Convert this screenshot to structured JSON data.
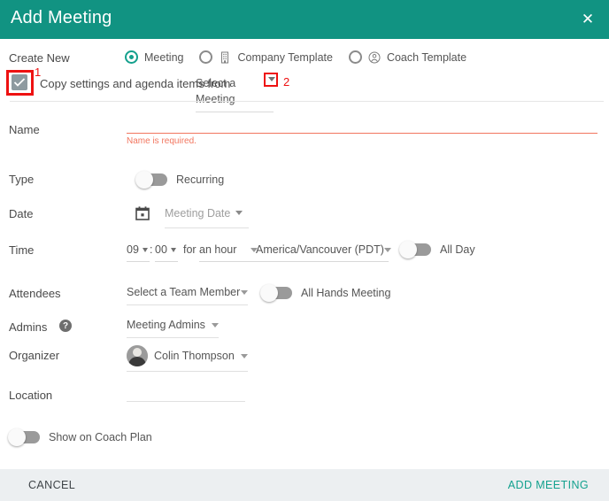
{
  "colors": {
    "header_bg": "#119382",
    "accent": "#13a18e",
    "error": "#f2765f",
    "annotation": "#ee1111",
    "footer_bg": "#eceff1",
    "checkbox_fill": "#8e9aa0"
  },
  "header": {
    "title": "Add Meeting",
    "close_label": "✕"
  },
  "create_new": {
    "label": "Create New",
    "options": [
      {
        "label": "Meeting",
        "selected": true,
        "icon": ""
      },
      {
        "label": "Company Template",
        "selected": false,
        "icon": "building-icon"
      },
      {
        "label": "Coach Template",
        "selected": false,
        "icon": "person-circle-icon"
      }
    ]
  },
  "copy_row": {
    "checkbox_checked": true,
    "label": "Copy settings and agenda items from",
    "select_value": "Select a Meeting",
    "annotation_1": "1",
    "annotation_2": "2"
  },
  "fields": {
    "name": {
      "label": "Name",
      "value": "",
      "placeholder": "",
      "error": "Name is required."
    },
    "type": {
      "label": "Type",
      "toggle_label": "Recurring",
      "toggle_on": false
    },
    "date": {
      "label": "Date",
      "icon": "calendar-icon",
      "select_value": "Meeting Date"
    },
    "time": {
      "label": "Time",
      "hour": "09",
      "colon": ":",
      "minute": "00",
      "for_label": "for",
      "duration": "an hour",
      "timezone": "America/Vancouver (PDT)",
      "allday_label": "All Day",
      "allday_on": false
    },
    "attendees": {
      "label": "Attendees",
      "select_value": "Select a Team Member",
      "allhands_label": "All Hands Meeting",
      "allhands_on": false
    },
    "admins": {
      "label": "Admins",
      "help_icon": "?",
      "select_value": "Meeting Admins"
    },
    "organizer": {
      "label": "Organizer",
      "avatar": "user-avatar",
      "name": "Colin Thompson"
    },
    "location": {
      "label": "Location",
      "value": "",
      "placeholder": ""
    }
  },
  "coach_plan": {
    "toggle_label": "Show on Coach Plan",
    "toggle_on": false
  },
  "footer": {
    "cancel_label": "CANCEL",
    "submit_label": "ADD MEETING"
  }
}
